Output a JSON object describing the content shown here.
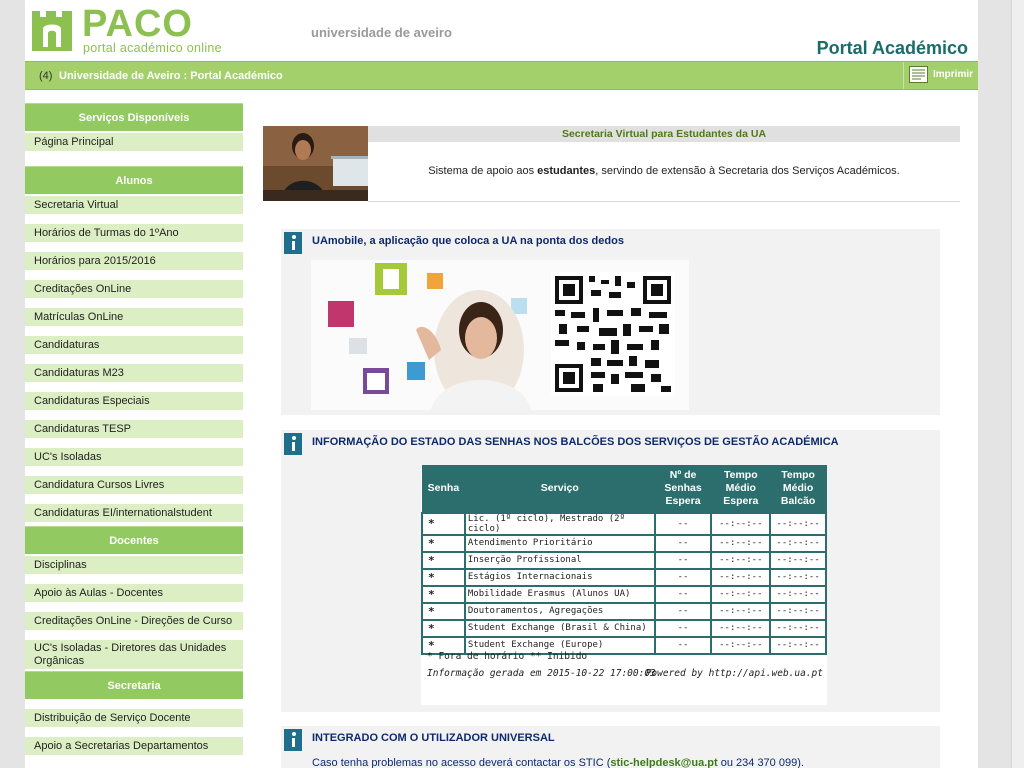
{
  "header": {
    "logo_word": "PACO",
    "logo_subtitle": "portal académico online",
    "university": "universidade de aveiro",
    "portal_title": "Portal Académico"
  },
  "breadcrumb": {
    "count": "(4)",
    "path": "Universidade de Aveiro : Portal Académico",
    "print_label": "Imprimir"
  },
  "sidebar": {
    "sections": [
      {
        "title": "Serviços Disponíveis",
        "items": [
          "Página Principal"
        ]
      },
      {
        "title": "Alunos",
        "items": [
          "Secretaria Virtual",
          "Horários de Turmas do 1ºAno",
          "Horários para 2015/2016",
          "Creditações OnLine",
          "Matrículas OnLine",
          "Candidaturas",
          "Candidaturas M23",
          "Candidaturas Especiais",
          "Candidaturas TESP",
          "UC's Isoladas",
          "Candidatura Cursos Livres",
          "Candidaturas EI/internationalstudent"
        ]
      },
      {
        "title": "Docentes",
        "items": [
          "Disciplinas",
          "Apoio às Aulas - Docentes",
          "Creditações OnLine - Direções de Curso",
          "UC's Isoladas - Diretores das Unidades Orgânicas"
        ]
      },
      {
        "title": "Secretaria",
        "items": [
          "Distribuição de Serviço Docente",
          "Apoio a Secretarias Departamentos"
        ]
      }
    ]
  },
  "secretaria_virtual": {
    "title": "Secretaria Virtual para Estudantes da UA",
    "desc_before": "Sistema de apoio aos ",
    "desc_bold": "estudantes",
    "desc_after": ", servindo de extensão à Secretaria dos Serviços Académicos."
  },
  "uamobile": {
    "title": "UAmobile, a aplicação que coloca a UA na ponta dos dedos"
  },
  "senhas": {
    "title": "INFORMAÇÃO DO ESTADO DAS SENHAS NOS BALCÕES DOS SERVIÇOS DE GESTÃO ACADÉMICA",
    "columns": [
      "Senha",
      "Serviço",
      "Nº de Senhas Espera",
      "Tempo Médio Espera",
      "Tempo Médio Balcão"
    ],
    "rows": [
      {
        "senha": "*",
        "servico": "Lic. (1º ciclo), Mestrado (2º ciclo)",
        "espera": "--",
        "tempo_espera": "--:--:--",
        "tempo_balcao": "--:--:--"
      },
      {
        "senha": "*",
        "servico": "Atendimento Prioritário",
        "espera": "--",
        "tempo_espera": "--:--:--",
        "tempo_balcao": "--:--:--"
      },
      {
        "senha": "*",
        "servico": "Inserção Profissional",
        "espera": "--",
        "tempo_espera": "--:--:--",
        "tempo_balcao": "--:--:--"
      },
      {
        "senha": "*",
        "servico": "Estágios Internacionais",
        "espera": "--",
        "tempo_espera": "--:--:--",
        "tempo_balcao": "--:--:--"
      },
      {
        "senha": "*",
        "servico": "Mobilidade Erasmus (Alunos UA)",
        "espera": "--",
        "tempo_espera": "--:--:--",
        "tempo_balcao": "--:--:--"
      },
      {
        "senha": "*",
        "servico": "Doutoramentos, Agregações",
        "espera": "--",
        "tempo_espera": "--:--:--",
        "tempo_balcao": "--:--:--"
      },
      {
        "senha": "*",
        "servico": "Student Exchange (Brasil & China)",
        "espera": "--",
        "tempo_espera": "--:--:--",
        "tempo_balcao": "--:--:--"
      },
      {
        "senha": "*",
        "servico": "Student Exchange (Europe)",
        "espera": "--",
        "tempo_espera": "--:--:--",
        "tempo_balcao": "--:--:--"
      }
    ],
    "legend": "* Fora de horário  ** Inibido",
    "generated": "Informação gerada em 2015-10-22 17:00:03",
    "powered": "Powered by http://api.web.ua.pt"
  },
  "utilizador": {
    "title": "INTEGRADO COM O UTILIZADOR UNIVERSAL",
    "text_before": "Caso tenha problemas no acesso deverá contactar os STIC (",
    "email": "stic-helpdesk@ua.pt",
    "text_after": " ou 234 370 099)."
  },
  "colors": {
    "green": "#a3d06a",
    "menu_bg": "#dcefc4",
    "teal": "#2b6e6d",
    "title_blue": "#0d2a6f"
  }
}
